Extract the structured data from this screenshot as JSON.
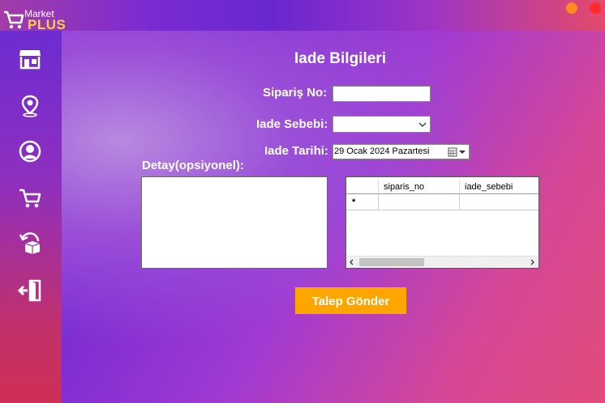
{
  "app": {
    "brand_top": "Market",
    "brand_bottom": "PLUS",
    "window_buttons": [
      {
        "name": "minimize",
        "color": "#ff8a1f"
      },
      {
        "name": "close",
        "color": "#ff2a2a"
      }
    ]
  },
  "sidebar": {
    "items": [
      {
        "icon": "store-icon"
      },
      {
        "icon": "location-pin-icon"
      },
      {
        "icon": "user-icon"
      },
      {
        "icon": "cart-icon"
      },
      {
        "icon": "return-box-icon"
      },
      {
        "icon": "logout-icon"
      }
    ]
  },
  "form": {
    "title": "Iade Bilgileri",
    "order_no_label": "Sipariş No:",
    "order_no_value": "",
    "reason_label": "Iade Sebebi:",
    "reason_value": "",
    "date_label": "Iade Tarihi:",
    "date_value": "29  Ocak  2024 Pazartesi",
    "details_label": "Detay(opsiyonel):",
    "details_value": "",
    "submit_label": "Talep Gönder"
  },
  "grid": {
    "columns": [
      "siparis_no",
      "iade_sebebi"
    ],
    "new_row_marker": "*",
    "rows": []
  },
  "colors": {
    "accent_button": "#ffa500",
    "brand_yellow": "#ffd23a"
  }
}
